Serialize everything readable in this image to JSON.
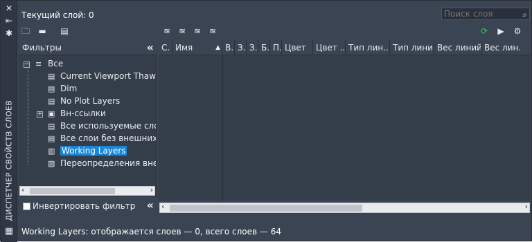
{
  "window": {
    "vertical_title": "ДИСПЕТЧЕР СВОЙСТВ СЛОЕВ"
  },
  "header": {
    "current_layer": "Текущий слой: 0",
    "search_placeholder": "Поиск слоя"
  },
  "filters": {
    "title": "Фильтры",
    "tree": [
      {
        "label": "Все",
        "icon": "layers-stack-icon"
      },
      {
        "label": "Current Viewport Thawed",
        "icon": "filter-icon"
      },
      {
        "label": "Dim",
        "icon": "filter-icon"
      },
      {
        "label": "No Plot Layers",
        "icon": "filter-icon"
      },
      {
        "label": "Вн-ссылки",
        "icon": "xref-filter-icon"
      },
      {
        "label": "Все используемые слои",
        "icon": "filter-icon"
      },
      {
        "label": "Все слои без внешних ссылок",
        "icon": "filter-icon"
      },
      {
        "label": "Working Layers",
        "icon": "group-filter-icon"
      },
      {
        "label": "Переопределения внешних",
        "icon": "override-filter-icon"
      }
    ],
    "selected": "Working Layers",
    "invert_label": "Инвертировать фильтр"
  },
  "grid": {
    "columns": [
      "С.",
      "Имя",
      "В.",
      "З.",
      "З.",
      "Б.",
      "П.",
      "Цвет",
      "Цвет ...",
      "Тип лин...",
      "Тип лини...",
      "Вес линий",
      "Вес лин..."
    ]
  },
  "status": {
    "text": "Working Layers: отображается слоев — 0, всего слоев — 64"
  }
}
